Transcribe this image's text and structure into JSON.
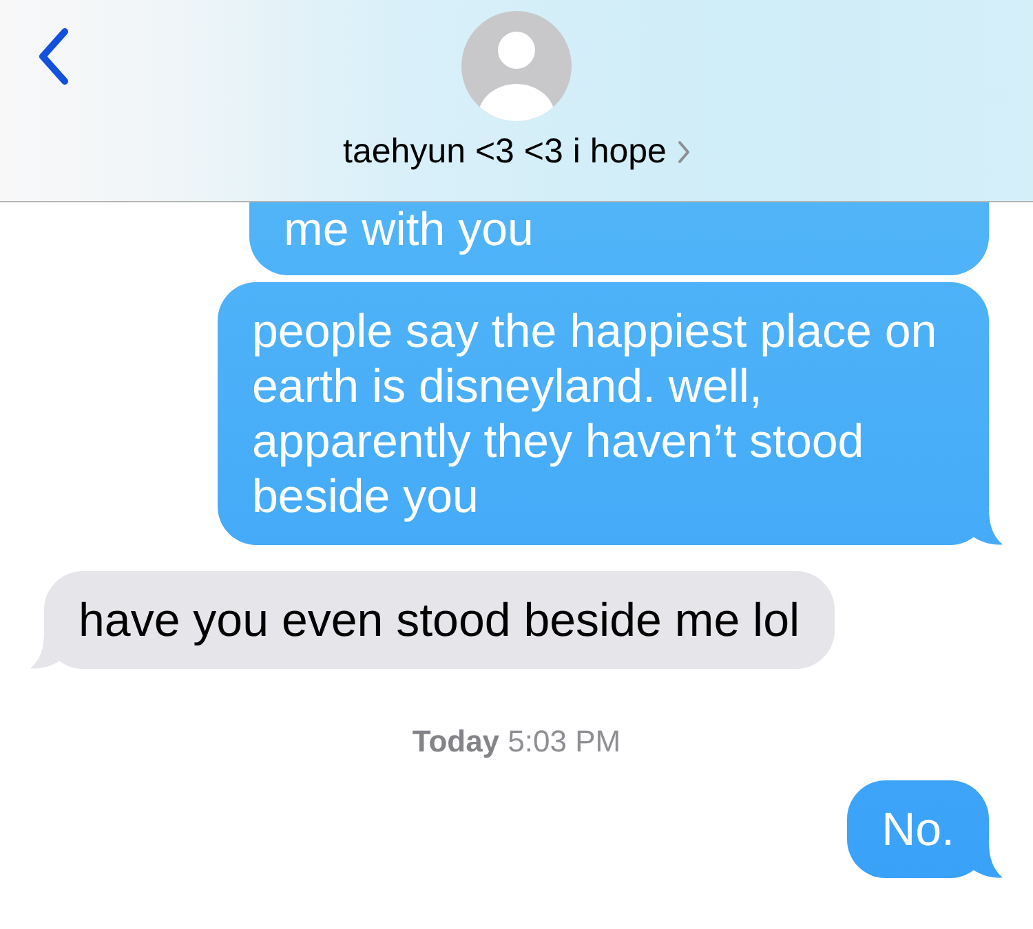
{
  "header": {
    "contact_name": "taehyun <3 <3 i hope"
  },
  "messages": [
    {
      "kind": "sent",
      "text": "me with you",
      "tail": false,
      "cut_off": true
    },
    {
      "kind": "sent",
      "text": "people say the happiest place on earth is disneyland. well, apparently they haven’t stood beside you",
      "tail": true,
      "cut_off": false
    },
    {
      "kind": "received",
      "text": "have you even stood beside me lol",
      "tail": true,
      "cut_off": false
    },
    {
      "kind": "timestamp",
      "text": "**Today** 5:03 PM"
    },
    {
      "kind": "sent",
      "text": "No.",
      "tail": true,
      "cut_off": false
    }
  ]
}
